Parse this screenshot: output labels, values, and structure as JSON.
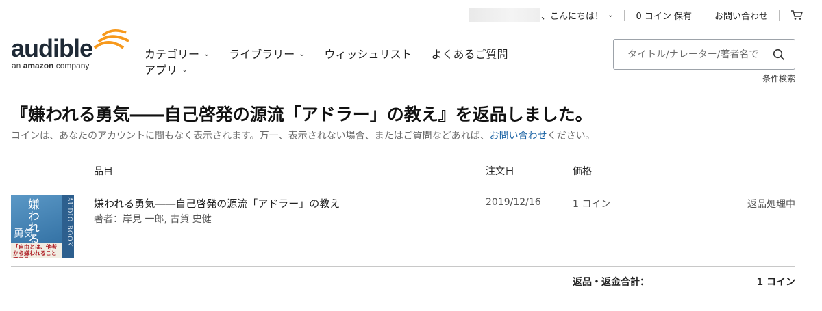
{
  "header": {
    "greeting": "、こんにちは！",
    "coins": "0 コイン 保有",
    "contact": "お問い合わせ",
    "cart_icon": "cart-icon"
  },
  "logo": {
    "wordmark": "audible",
    "tagline_prefix": "an ",
    "tagline_brand": "amazon",
    "tagline_suffix": " company",
    "accent_color": "#f7991c"
  },
  "nav": {
    "items": [
      {
        "label": "カテゴリー",
        "dropdown": true
      },
      {
        "label": "ライブラリー",
        "dropdown": true
      },
      {
        "label": "ウィッシュリスト",
        "dropdown": false
      },
      {
        "label": "よくあるご質問",
        "dropdown": false
      }
    ],
    "apps_label": "アプリ"
  },
  "search": {
    "placeholder": "タイトル/ナレーター/著者名で",
    "advanced_label": "条件検索"
  },
  "page": {
    "title": "『嫌われる勇気――自己啓発の源流「アドラー」の教え』を返品しました。",
    "message_prefix": "コインは、あなたのアカウントに間もなく表示されます。万一、表示されない場合、またはご質問などあれば、",
    "message_link": "お問い合わせ",
    "message_suffix": "ください。",
    "link_color": "#1f66a6"
  },
  "table": {
    "headers": {
      "item": "品目",
      "order_date": "注文日",
      "price": "価格"
    },
    "rows": [
      {
        "title": "嫌われる勇気――自己啓発の源流「アドラー」の教え",
        "author": "著者：岸見 一郎, 古賀 史健",
        "date": "2019/12/16",
        "price": "1 コイン",
        "status": "返品処理中",
        "cover": {
          "title_vertical": "嫌われる",
          "title_line": "勇気",
          "spine_text": "AUDIO BOOK",
          "band_text": "「自由とは、他者から嫌われることである。」"
        }
      }
    ],
    "total_label": "返品・返金合計：",
    "total_value": "1 コイン"
  }
}
